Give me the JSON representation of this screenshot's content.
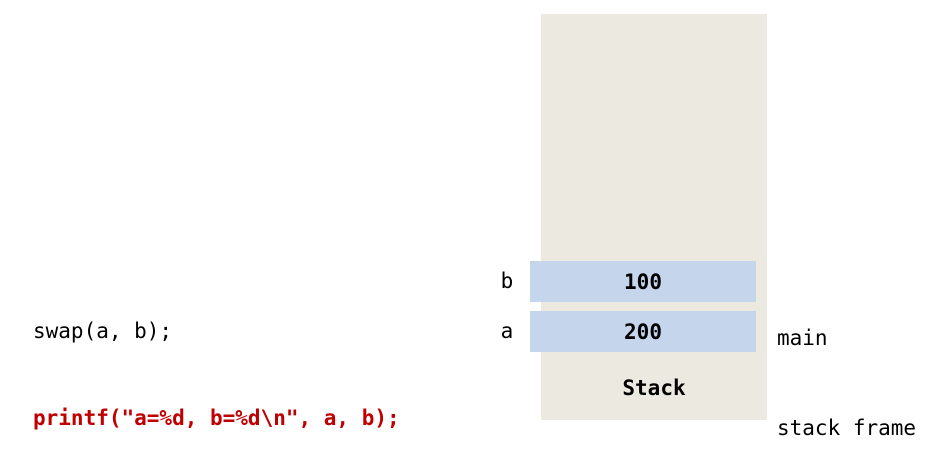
{
  "code": {
    "lines": [
      "swap(a, b);",
      "printf(\"a=%d, b=%d\\n\", a, b);"
    ]
  },
  "stack": {
    "title": "Stack",
    "frame_label_lines": [
      "main",
      "stack frame"
    ],
    "cells": [
      {
        "name": "b",
        "value": "100"
      },
      {
        "name": "a",
        "value": "200"
      }
    ]
  },
  "colors": {
    "stack_background": "#ece9e0",
    "cell_fill": "#c5d5ec",
    "highlight_text": "#c00000"
  }
}
